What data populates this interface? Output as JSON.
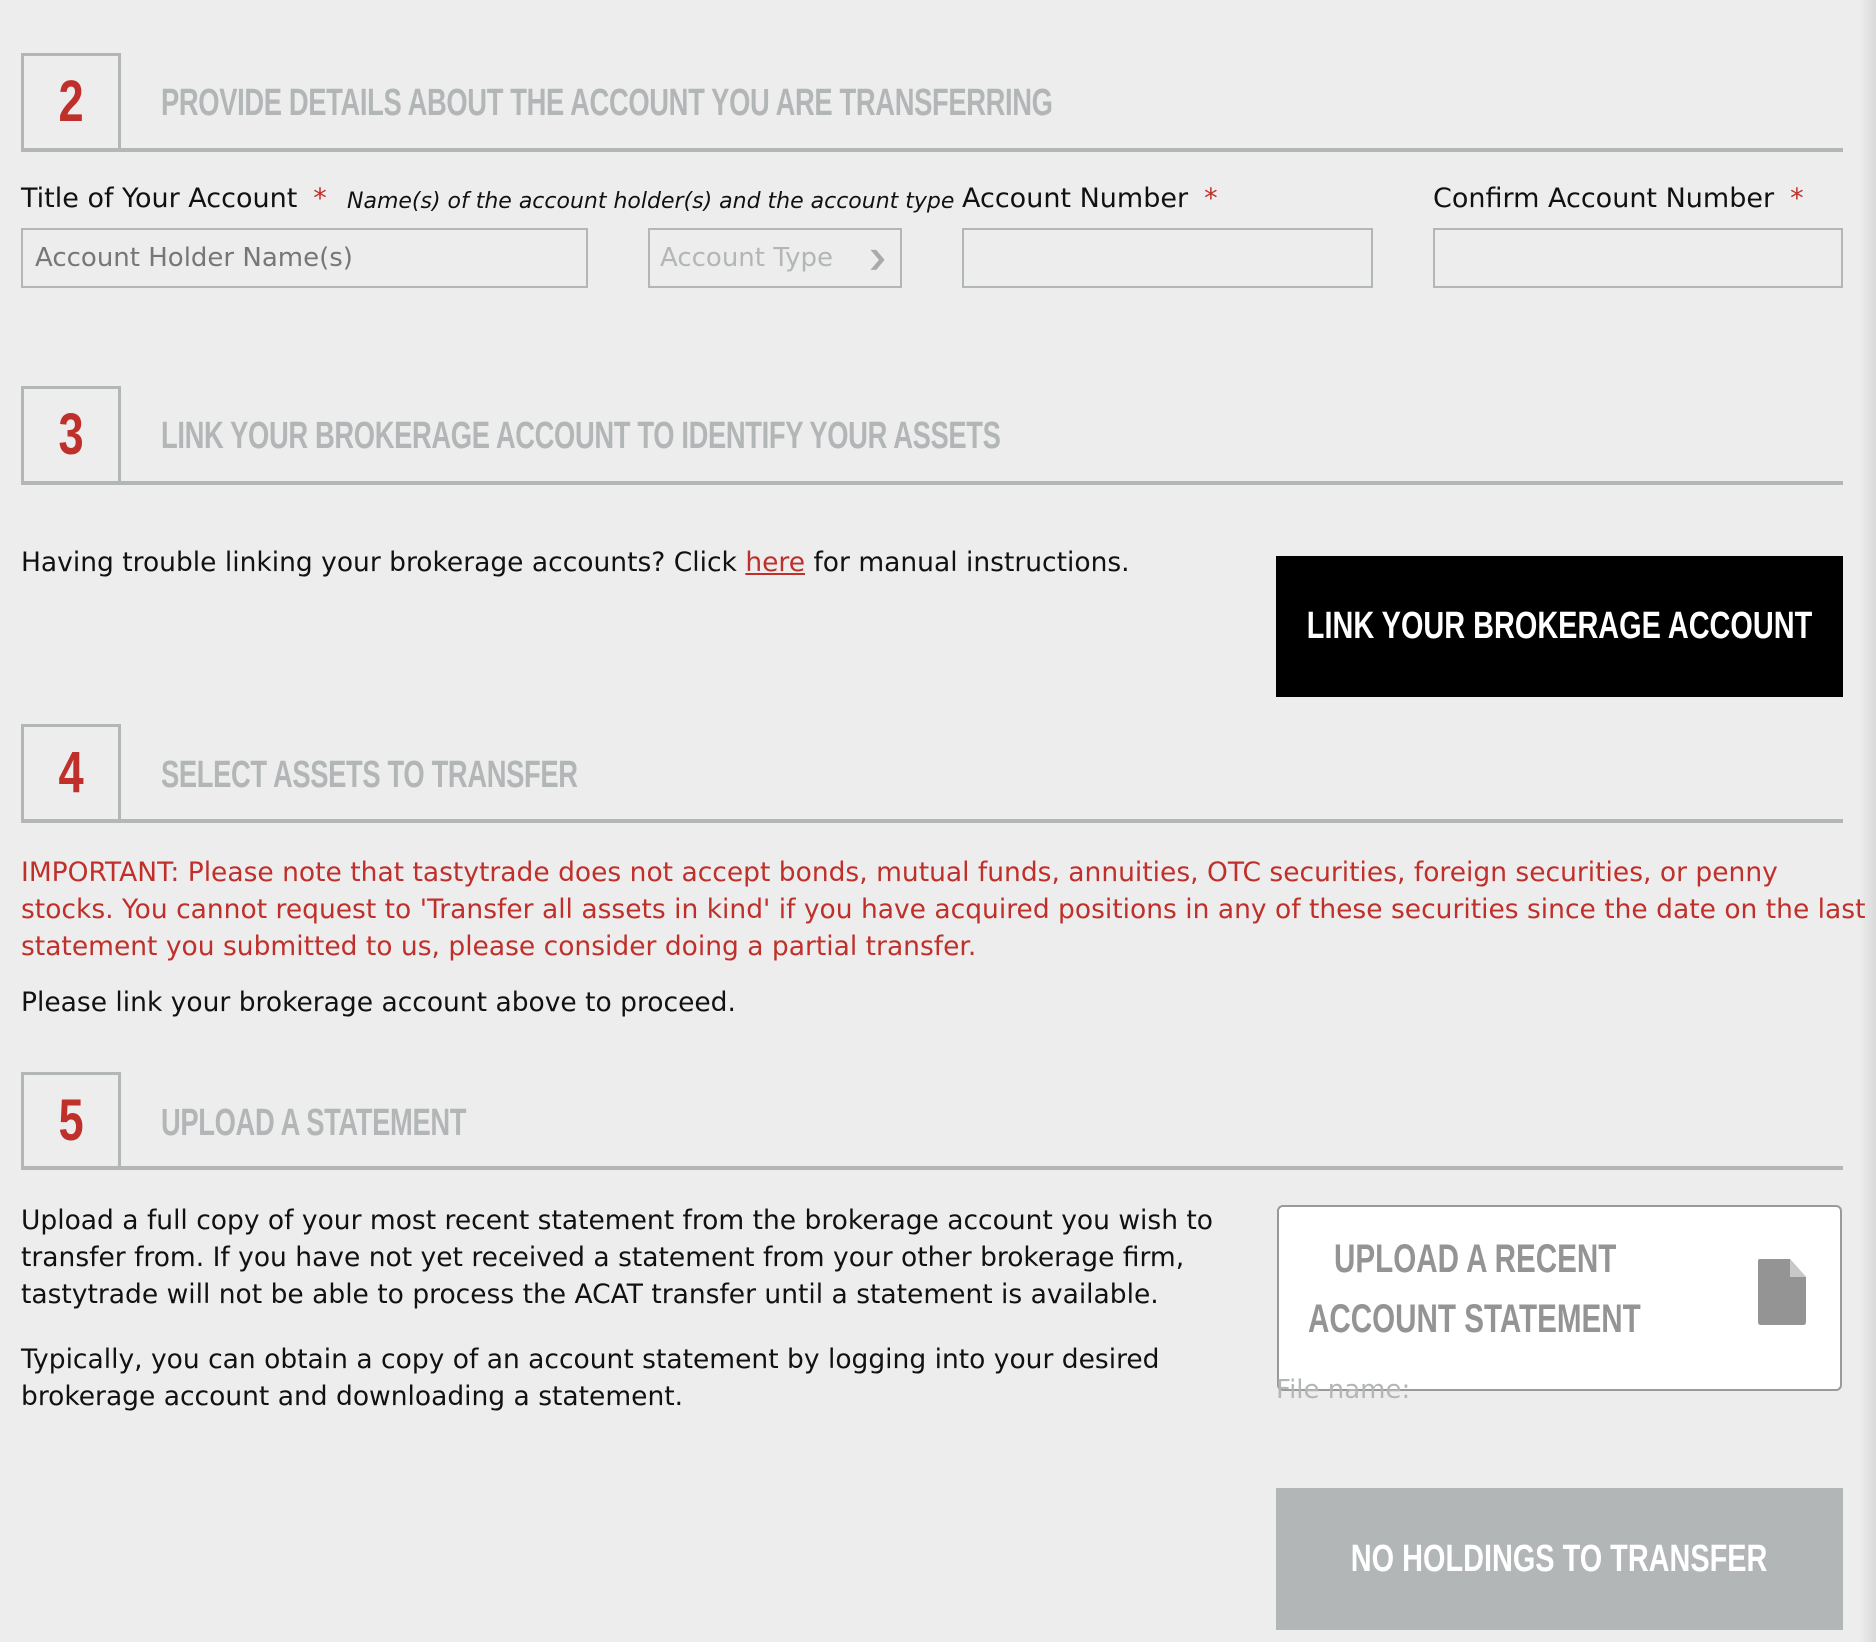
{
  "sections": {
    "s2": {
      "number": "2",
      "title": "PROVIDE DETAILS ABOUT THE ACCOUNT YOU ARE TRANSFERRING",
      "title_label": "Title of Your Account",
      "required_mark": "*",
      "title_hint": "Name(s) of the account holder(s) and the account type",
      "holder_placeholder": "Account Holder Name(s)",
      "holder_value": "",
      "account_type_selected": "Account Type",
      "account_number_label": "Account Number",
      "account_number_value": "",
      "confirm_label": "Confirm Account Number",
      "confirm_value": ""
    },
    "s3": {
      "number": "3",
      "title": "LINK YOUR BROKERAGE ACCOUNT TO IDENTIFY YOUR ASSETS",
      "help_prefix": "Having trouble linking your brokerage accounts? Click ",
      "help_link": "here",
      "help_suffix": " for manual instructions.",
      "link_button": "LINK YOUR BROKERAGE ACCOUNT"
    },
    "s4": {
      "number": "4",
      "title": "SELECT ASSETS TO TRANSFER",
      "important": "IMPORTANT: Please note that tastytrade does not accept bonds, mutual funds, annuities, OTC securities, foreign securities, or penny stocks. You cannot request to 'Transfer all assets in kind' if you have acquired positions in any of these securities since the date on the last statement you submitted to us, please consider doing a partial transfer.",
      "proceed_note": "Please link your brokerage account above to proceed."
    },
    "s5": {
      "number": "5",
      "title": "UPLOAD A STATEMENT",
      "para1": "Upload a full copy of your most recent statement from the brokerage account you wish to transfer from. If you have not yet received a statement from your other brokerage firm, tastytrade will not be able to process the ACAT transfer until a statement is available.",
      "para2": "Typically, you can obtain a copy of an account statement by logging into your desired brokerage account and downloading a statement.",
      "upload_line1": "UPLOAD A RECENT",
      "upload_line2": "ACCOUNT STATEMENT",
      "upload_icon": "file-icon",
      "file_name_label": "File name:",
      "submit_button": "NO HOLDINGS TO TRANSFER"
    }
  },
  "colors": {
    "accent_red": "#c0302b",
    "muted_grey": "#b3b6b7",
    "background": "#ededed"
  }
}
